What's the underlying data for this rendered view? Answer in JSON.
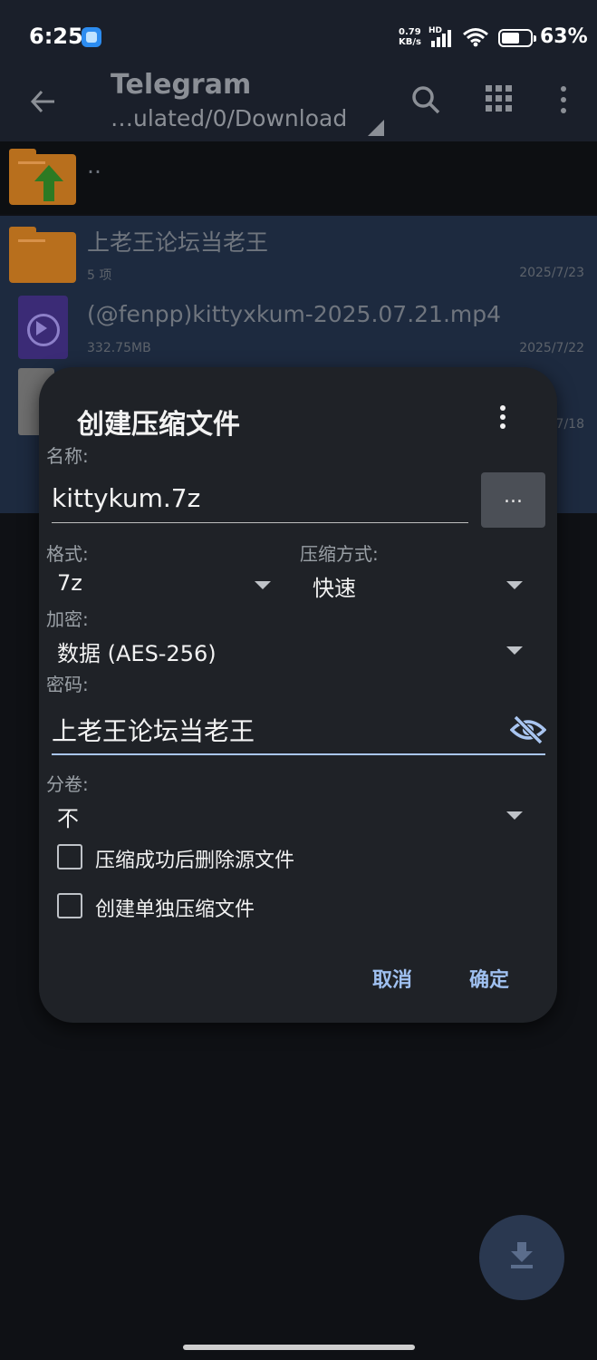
{
  "status": {
    "time": "6:25",
    "net_speed_value": "0.79",
    "net_speed_unit": "KB/s",
    "hd": "HD",
    "battery_percent": "63%",
    "battery_level": 0.63
  },
  "app_bar": {
    "title": "Telegram",
    "path": "…ulated/0/Download"
  },
  "files": {
    "parent": "..",
    "items": [
      {
        "name": "上老王论坛当老王",
        "meta": "5 项",
        "date": "2025/7/23",
        "type": "folder"
      },
      {
        "name": "(@fenpp)kittyxkum-2025.07.21.mp4",
        "meta": "332.75MB",
        "date": "2025/7/22",
        "type": "video"
      },
      {
        "name": "",
        "meta": "",
        "date": "7/18",
        "type": "document"
      }
    ]
  },
  "dialog": {
    "title": "创建压缩文件",
    "name_label": "名称:",
    "name_value": "kittykum.7z",
    "browse_label": "...",
    "format_label": "格式:",
    "format_value": "7z",
    "method_label": "压缩方式:",
    "method_value": "快速",
    "encryption_label": "加密:",
    "encryption_value": "数据 (AES-256)",
    "password_label": "密码:",
    "password_value": "上老王论坛当老王",
    "split_label": "分卷:",
    "split_value": "不",
    "checkbox_delete_label": "压缩成功后删除源文件",
    "checkbox_separate_label": "创建单独压缩文件",
    "cancel_label": "取消",
    "ok_label": "确定"
  },
  "colors": {
    "accent": "#9fc0f0",
    "selected_row": "#1d2a3f",
    "dialog_bg": "#1f2227",
    "folder": "#b86f1d"
  }
}
